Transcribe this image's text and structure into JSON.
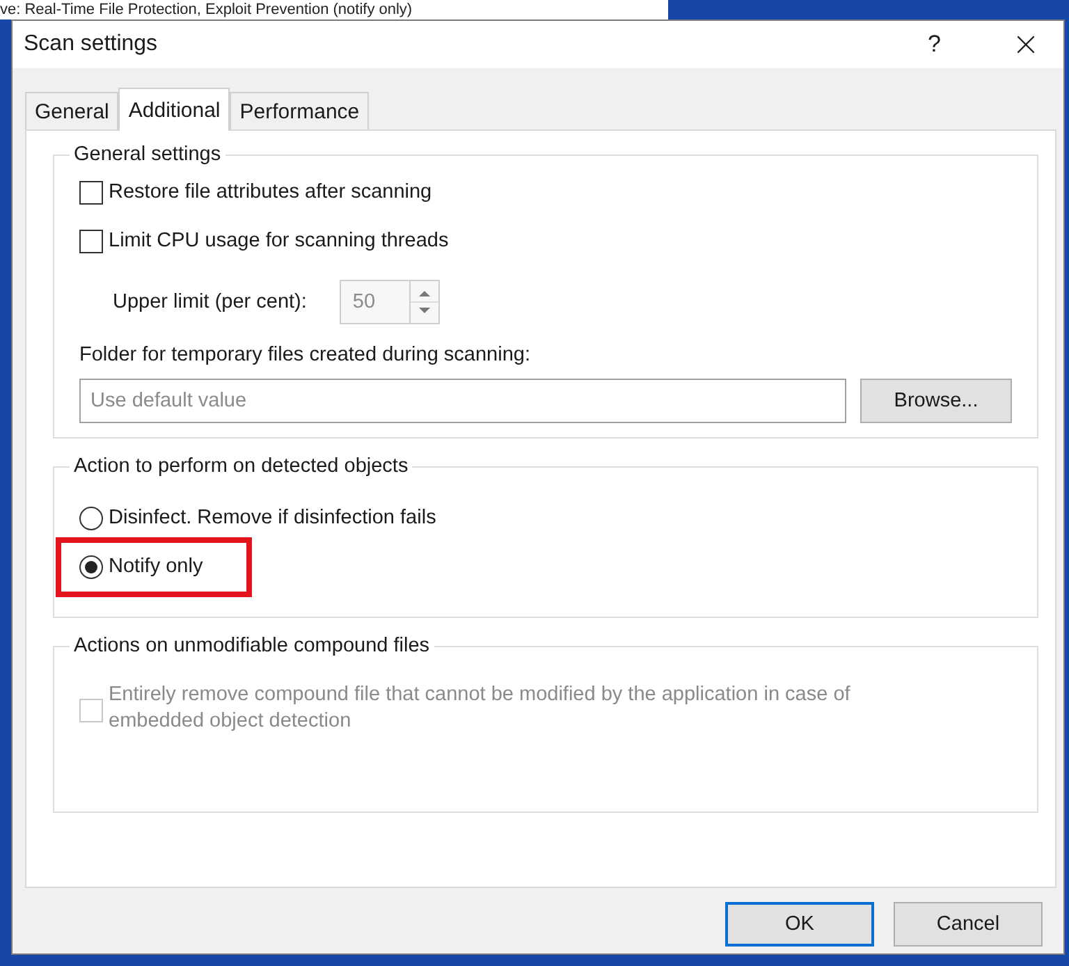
{
  "background_window": {
    "text": "ve: Real-Time File Protection, Exploit Prevention (notify only)"
  },
  "window": {
    "title": "Scan settings",
    "help": "?"
  },
  "tabs": [
    {
      "label": "General",
      "selected": false
    },
    {
      "label": "Additional",
      "selected": true
    },
    {
      "label": "Performance",
      "selected": false
    }
  ],
  "general_settings": {
    "title": "General settings",
    "checkboxes": [
      {
        "label": "Restore file attributes after scanning",
        "checked": false
      },
      {
        "label": "Limit CPU usage for scanning threads",
        "checked": false
      }
    ],
    "upper_limit": {
      "label": "Upper limit (per cent):",
      "value": "50",
      "disabled": true
    },
    "folder": {
      "label": "Folder for temporary files created during scanning:",
      "placeholder": "Use default value"
    },
    "browse": "Browse..."
  },
  "detected_objects": {
    "title": "Action to perform on detected objects",
    "options": [
      {
        "label": "Disinfect. Remove if disinfection fails",
        "selected": false,
        "highlighted": false
      },
      {
        "label": "Notify only",
        "selected": true,
        "highlighted": true
      }
    ]
  },
  "compound_files": {
    "title": "Actions on unmodifiable compound files",
    "checkbox": {
      "label": "Entirely remove compound file that cannot be modified by the application in case of embedded object detection",
      "checked": false,
      "disabled": true
    }
  },
  "buttons": [
    {
      "label": "OK",
      "default": true
    },
    {
      "label": "Cancel",
      "default": false
    }
  ]
}
